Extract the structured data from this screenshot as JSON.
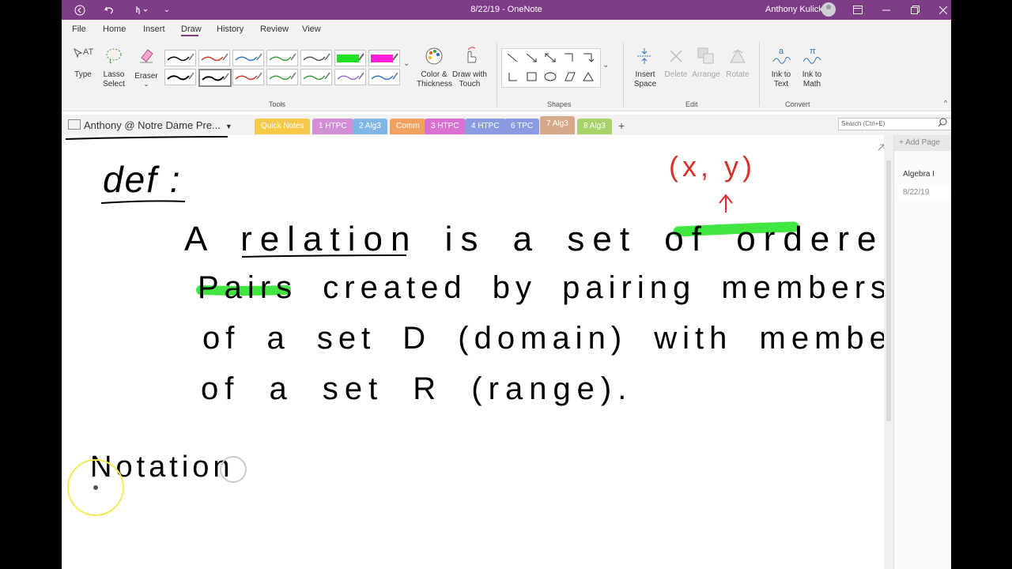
{
  "titlebar": {
    "title": "8/22/19 - OneNote",
    "user": "Anthony Kulick",
    "back_icon": "back-icon",
    "undo_icon": "undo-icon",
    "touch_icon": "touch-mode-icon"
  },
  "ribbon_tabs": [
    "File",
    "Home",
    "Insert",
    "Draw",
    "History",
    "Review",
    "View"
  ],
  "ribbon": {
    "type_label": "Type",
    "lasso_label": [
      "Lasso",
      "Select"
    ],
    "eraser_label": "Eraser",
    "color_thickness": [
      "Color &",
      "Thickness"
    ],
    "draw_touch": [
      "Draw with",
      "Touch"
    ],
    "insert_space": [
      "Insert",
      "Space"
    ],
    "delete": "Delete",
    "arrange": "Arrange",
    "rotate": "Rotate",
    "ink_to_text": [
      "Ink to",
      "Text"
    ],
    "ink_to_math": [
      "Ink to",
      "Math"
    ],
    "groups": [
      "Tools",
      "Shapes",
      "Edit",
      "Convert"
    ]
  },
  "notebook": {
    "name": "Anthony @ Notre Dame Pre...",
    "sections": [
      {
        "label": "Quick Notes",
        "color": "#f7c948"
      },
      {
        "label": "1 HTPC",
        "color": "#d38fd6"
      },
      {
        "label": "2 Alg3",
        "color": "#7fb6e6"
      },
      {
        "label": "Comm",
        "color": "#f0a35e"
      },
      {
        "label": "3 HTPC",
        "color": "#d871d0"
      },
      {
        "label": "4 HTPC",
        "color": "#8a9be0"
      },
      {
        "label": "6 TPC",
        "color": "#8a9be0"
      },
      {
        "label": "7 Alg3",
        "color": "#d5a88a"
      },
      {
        "label": "8 Alg3",
        "color": "#a9d26a"
      }
    ],
    "add_section": "+",
    "search_placeholder": "Search (Ctrl+E)"
  },
  "pages": {
    "add_page": "Add Page",
    "items": [
      "Algebra I",
      "8/22/19"
    ]
  },
  "ink": {
    "line_def": "def :",
    "annotation": "(x, y)",
    "line1": "A relation is a set of ordered",
    "line2": "Pairs created by pairing members",
    "line3": "of a set D (domain) with members",
    "line4": "of a set R (range).",
    "line5": "Notation",
    "colors": {
      "ink": "#000000",
      "red": "#d9302a",
      "highlight": "#2de32d"
    }
  }
}
